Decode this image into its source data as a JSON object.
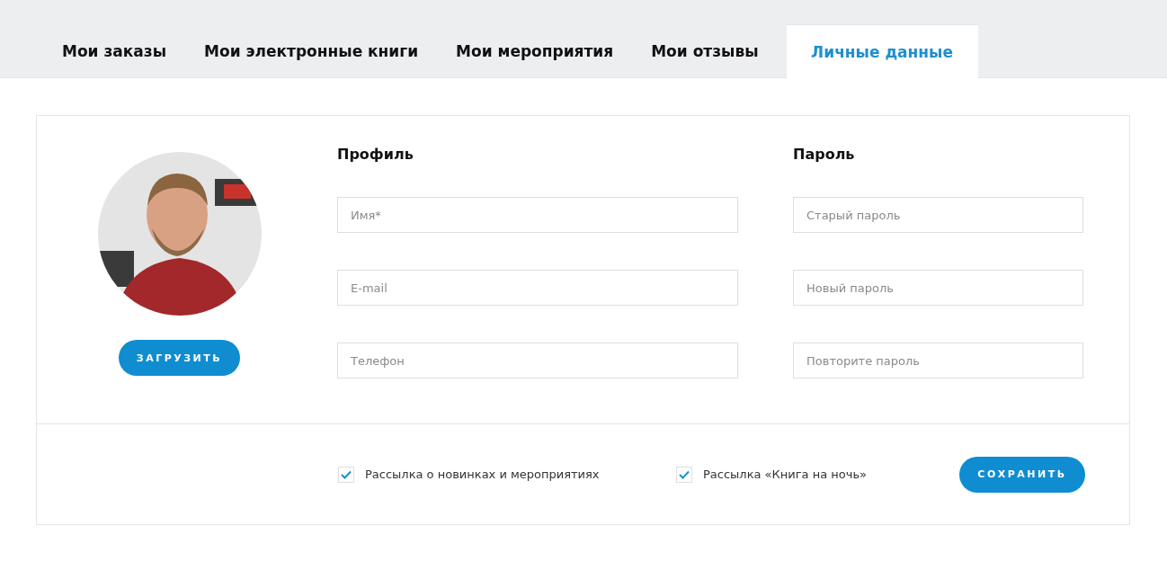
{
  "tabs": [
    {
      "label": "Мои заказы",
      "selected": false
    },
    {
      "label": "Мои электронные книги",
      "selected": false
    },
    {
      "label": "Мои мероприятия",
      "selected": false
    },
    {
      "label": "Мои отзывы",
      "selected": false
    },
    {
      "label": "Личные данные",
      "selected": true
    }
  ],
  "avatar": {
    "kind": "picture",
    "button": "ЗАГРУЗИТЬ"
  },
  "profile": {
    "heading": "Профиль",
    "fields": [
      {
        "placeholder": "Имя*"
      },
      {
        "placeholder": "E-mail"
      },
      {
        "placeholder": "Телефон"
      }
    ]
  },
  "password": {
    "heading": "Пароль",
    "fields": [
      {
        "placeholder": "Старый пароль"
      },
      {
        "placeholder": "Новый пароль"
      },
      {
        "placeholder": "Повторите пароль"
      }
    ]
  },
  "subscriptions": [
    {
      "label": "Рассылка о новинках и мероприятиях",
      "checked": true
    },
    {
      "label": "Рассылка «Книга на ночь»",
      "checked": true
    }
  ],
  "save_button": "СОХРАНИТЬ"
}
